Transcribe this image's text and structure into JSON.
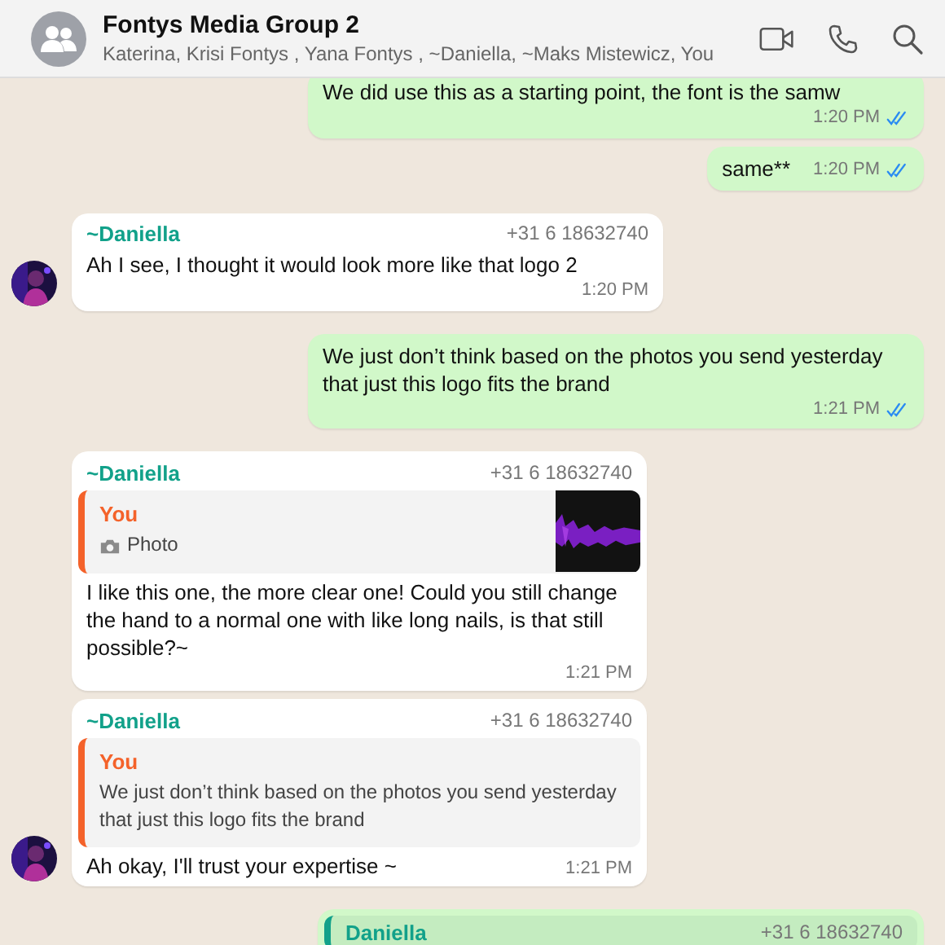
{
  "header": {
    "title": "Fontys Media Group 2",
    "members": "Katerina, Krisi Fontys , Yana Fontys , ~Daniella, ~Maks Mistewicz, You"
  },
  "messages": [
    {
      "kind": "out",
      "text": "We did use this as a starting point, the font is the samw",
      "time": "1:20 PM",
      "read": true
    },
    {
      "kind": "out",
      "text": "same**",
      "time": "1:20 PM",
      "read": true
    },
    {
      "kind": "in",
      "sender": "~Daniella",
      "phone": "+31 6 18632740",
      "text": "Ah I see, I thought it would look more like that logo 2",
      "time": "1:20 PM",
      "avatar": true
    },
    {
      "kind": "out",
      "text": "We just don’t think based on the photos you send yesterday that just this logo fits the brand",
      "time": "1:21 PM",
      "read": true
    },
    {
      "kind": "in",
      "sender": "~Daniella",
      "phone": "+31 6 18632740",
      "quote": {
        "author": "You",
        "text": "Photo"
      },
      "text": "I like this one, the more clear one! Could you still change the hand to a normal one with like long nails, is that still possible?~",
      "time": "1:21 PM",
      "avatar": false
    },
    {
      "kind": "in",
      "sender": "~Daniella",
      "phone": "+31 6 18632740",
      "quote": {
        "author": "You",
        "kind": "text",
        "text": "We just don’t think based on the photos you send yesterday that just this logo fits the brand"
      },
      "text": "Ah okay, I'll trust your expertise ~",
      "time": "1:21 PM",
      "avatar": true
    },
    {
      "kind": "out",
      "quote": {
        "author": "Daniella",
        "kind": "cut",
        "phone": "+31 6 18632740"
      }
    }
  ]
}
